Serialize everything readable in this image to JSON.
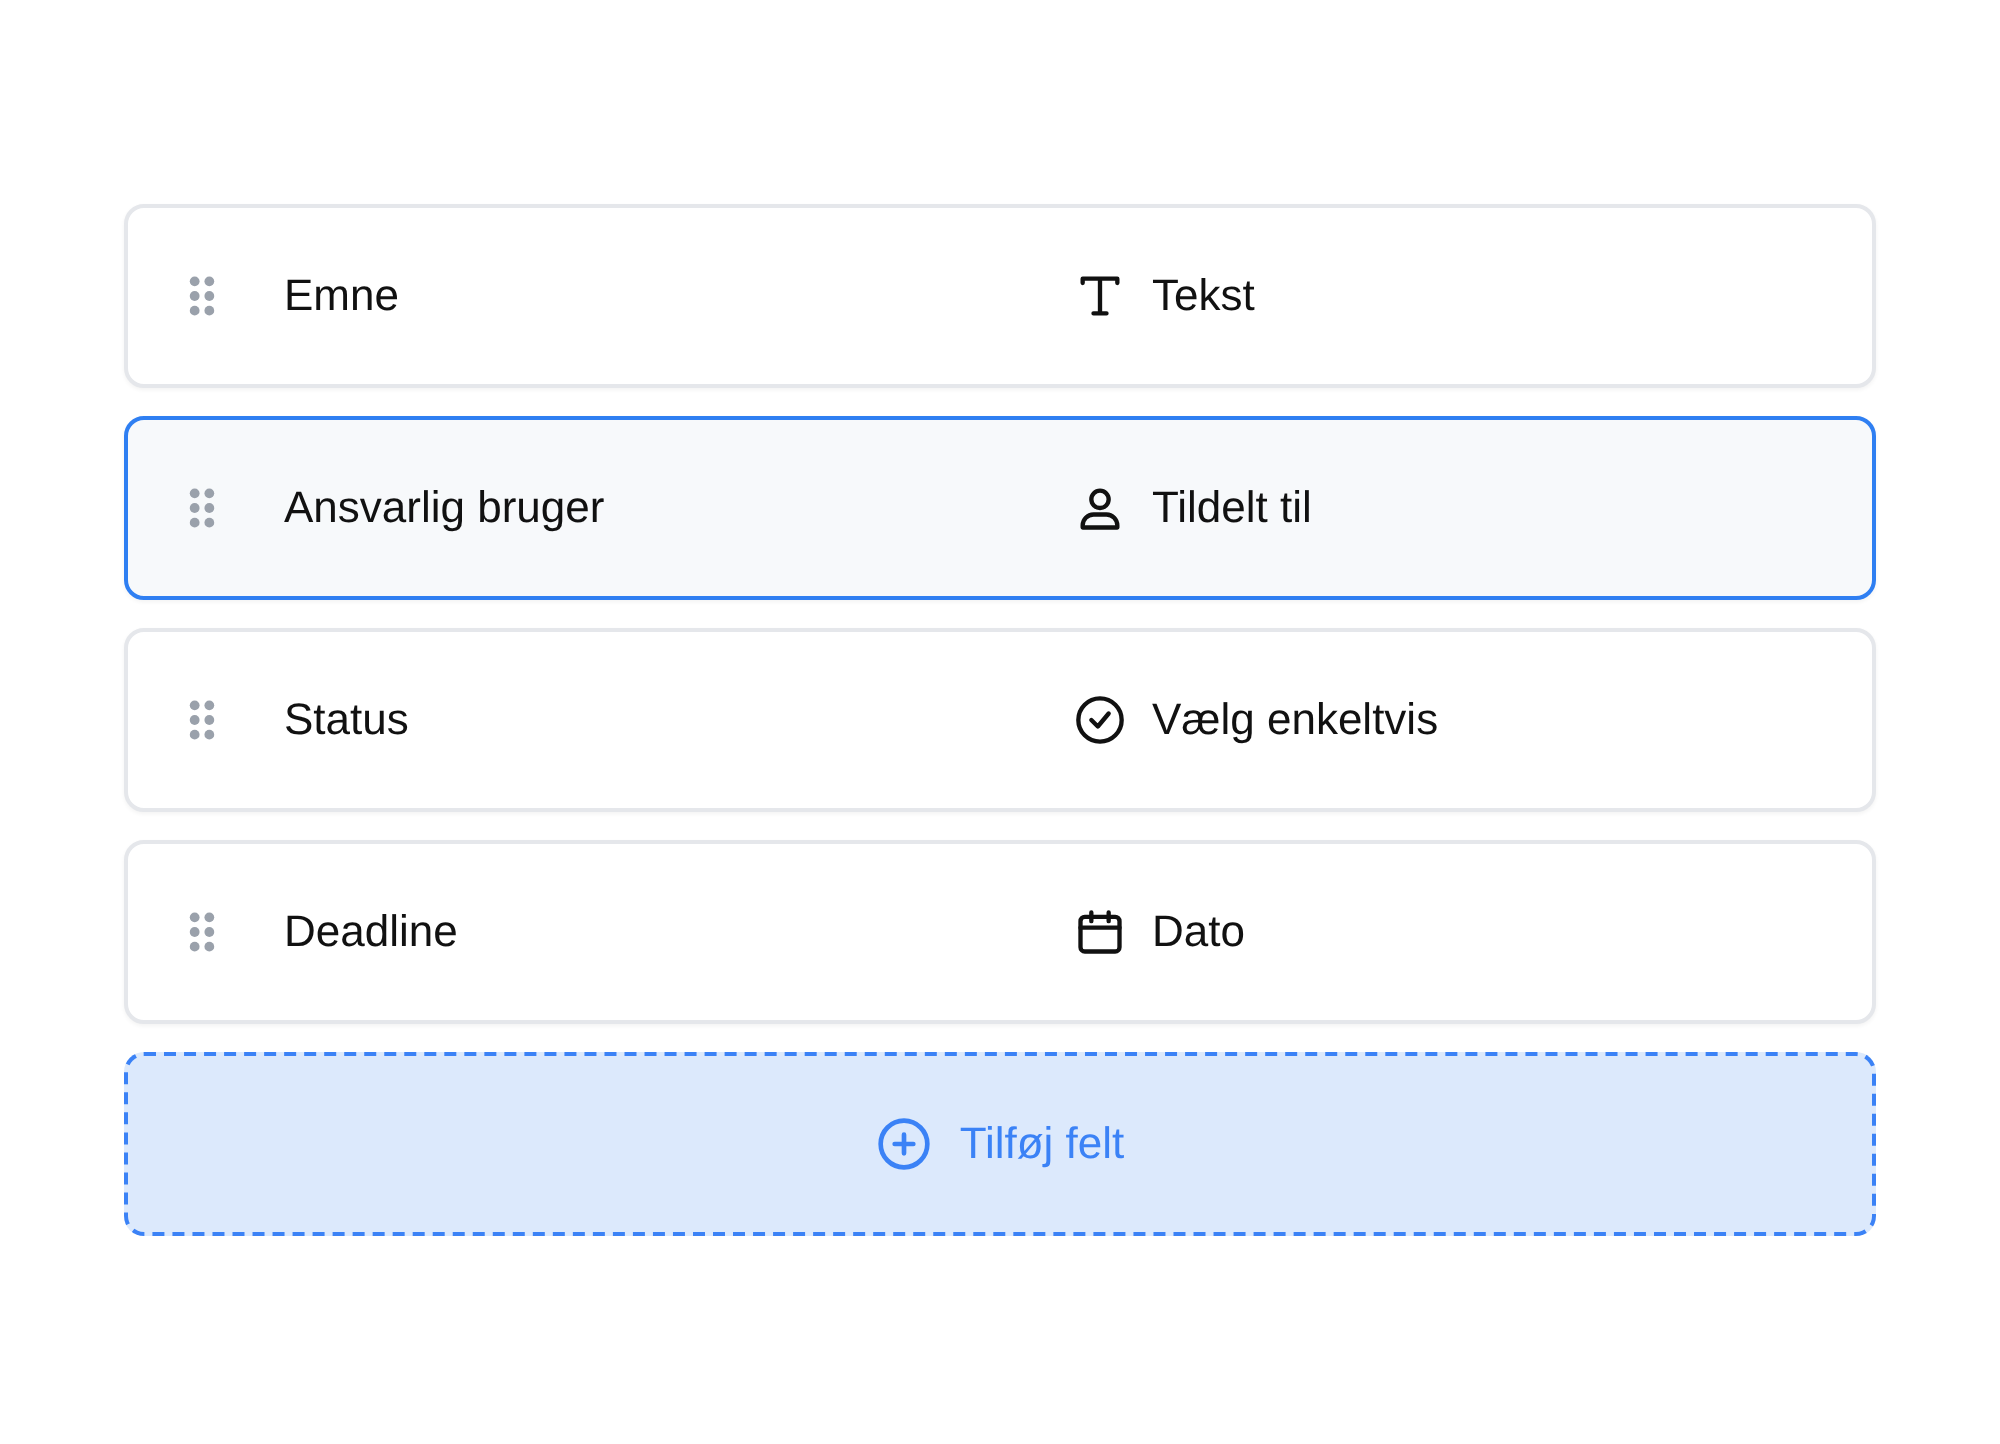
{
  "fields": [
    {
      "name": "Emne",
      "type": {
        "kind": "text",
        "label": "Tekst"
      },
      "selected": false
    },
    {
      "name": "Ansvarlig bruger",
      "type": {
        "kind": "user",
        "label": "Tildelt til"
      },
      "selected": true
    },
    {
      "name": "Status",
      "type": {
        "kind": "single-select",
        "label": "Vælg enkeltvis"
      },
      "selected": false
    },
    {
      "name": "Deadline",
      "type": {
        "kind": "date",
        "label": "Dato"
      },
      "selected": false
    }
  ],
  "add_button": {
    "label": "Tilføj felt"
  }
}
